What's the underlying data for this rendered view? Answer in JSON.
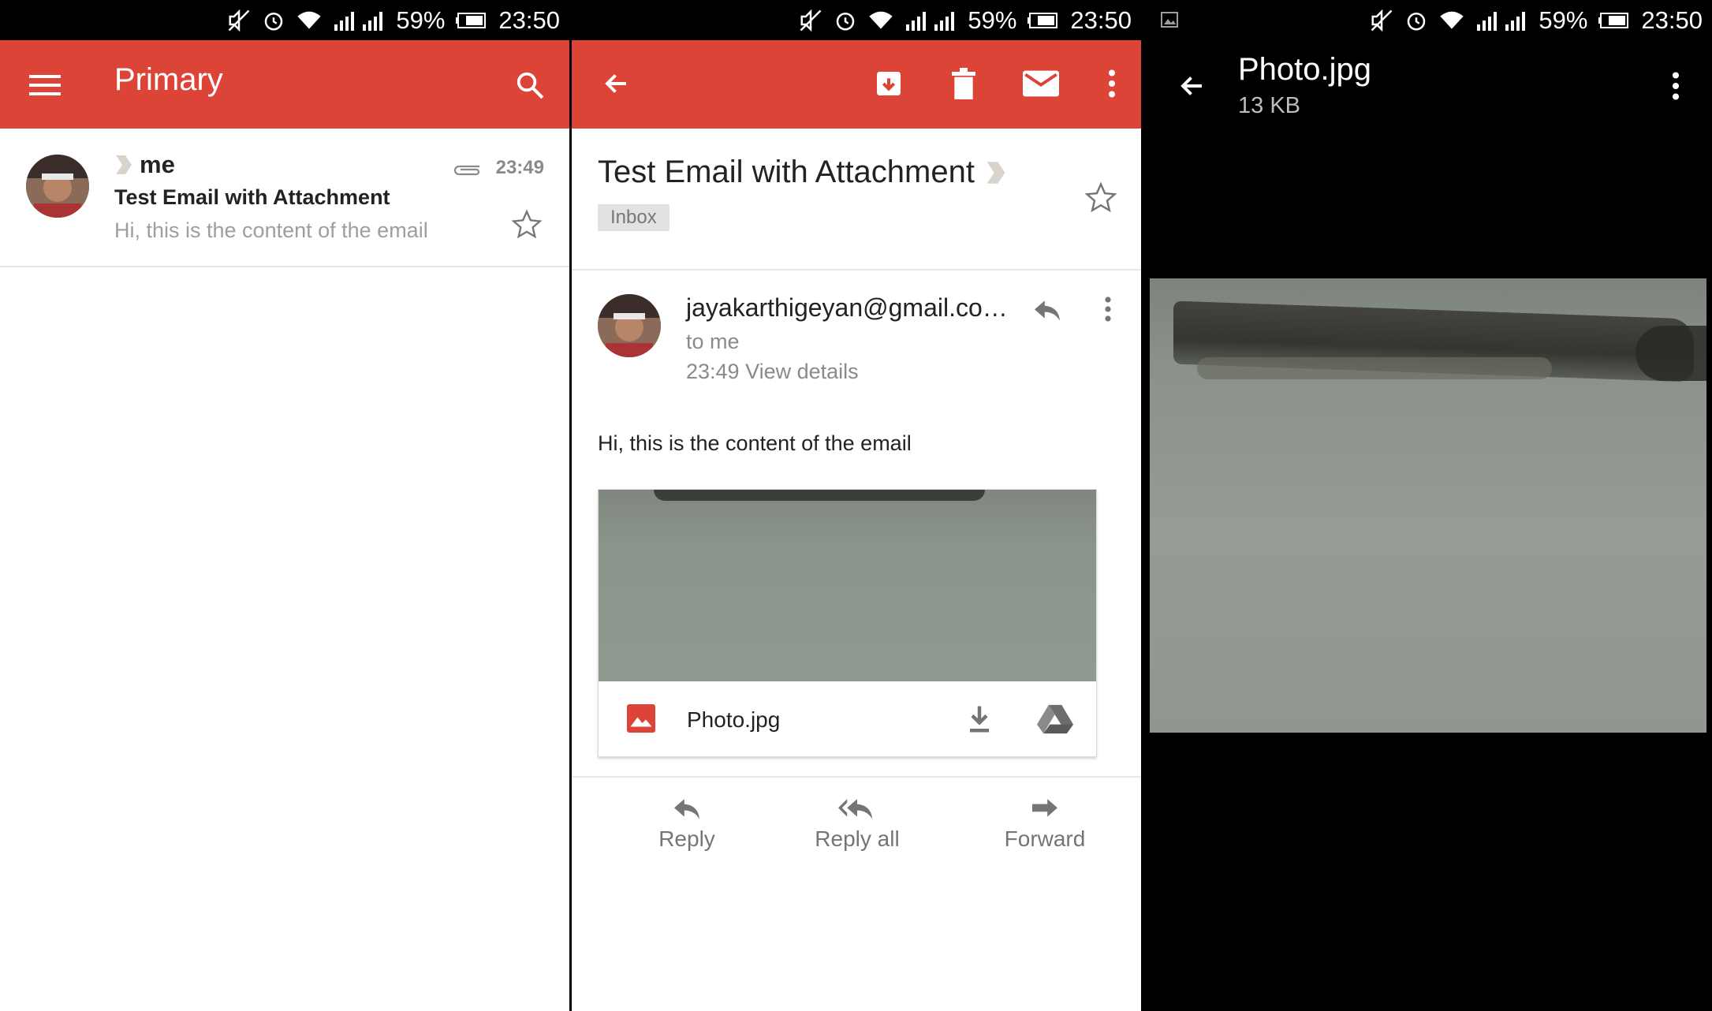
{
  "status": {
    "battery": "59%",
    "time": "23:50"
  },
  "inbox": {
    "title": "Primary",
    "item": {
      "sender": "me",
      "time": "23:49",
      "subject": "Test Email with Attachment",
      "snippet": "Hi, this is the content of the email"
    }
  },
  "message": {
    "subject": "Test Email with Attachment",
    "label": "Inbox",
    "from": "jayakarthigeyan@gmail.co…",
    "to": "to me",
    "time": "23:49",
    "details_link": "View details",
    "body": "Hi, this is the content of the email",
    "attachment": {
      "name": "Photo.jpg"
    },
    "actions": {
      "reply": "Reply",
      "reply_all": "Reply all",
      "forward": "Forward"
    }
  },
  "viewer": {
    "title": "Photo.jpg",
    "size": "13 KB"
  },
  "colors": {
    "primary": "#db4437",
    "icon_gray": "#757575",
    "drive_gray": "#6d6d6d"
  }
}
